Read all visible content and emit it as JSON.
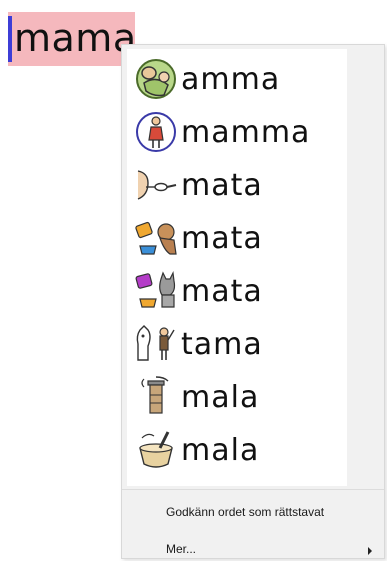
{
  "document": {
    "typed_word": "mama"
  },
  "context_menu": {
    "suggestions": [
      {
        "word": "amma",
        "icon": "nursing-mother-icon"
      },
      {
        "word": "mamma",
        "icon": "mother-figure-icon"
      },
      {
        "word": "mata",
        "icon": "spoon-feeding-icon"
      },
      {
        "word": "mata",
        "icon": "feeding-dog-icon"
      },
      {
        "word": "mata",
        "icon": "feeding-cat-icon"
      },
      {
        "word": "tama",
        "icon": "taming-animal-icon"
      },
      {
        "word": "mala",
        "icon": "grinder-icon"
      },
      {
        "word": "mala",
        "icon": "mortar-pestle-icon"
      }
    ],
    "accept_label": "Godkänn ordet som rättstavat",
    "more_label": "Mer..."
  },
  "colors": {
    "highlight": "#f5b8bd",
    "caret": "#3d3dd6",
    "menu_bg": "#f1f1f1"
  }
}
